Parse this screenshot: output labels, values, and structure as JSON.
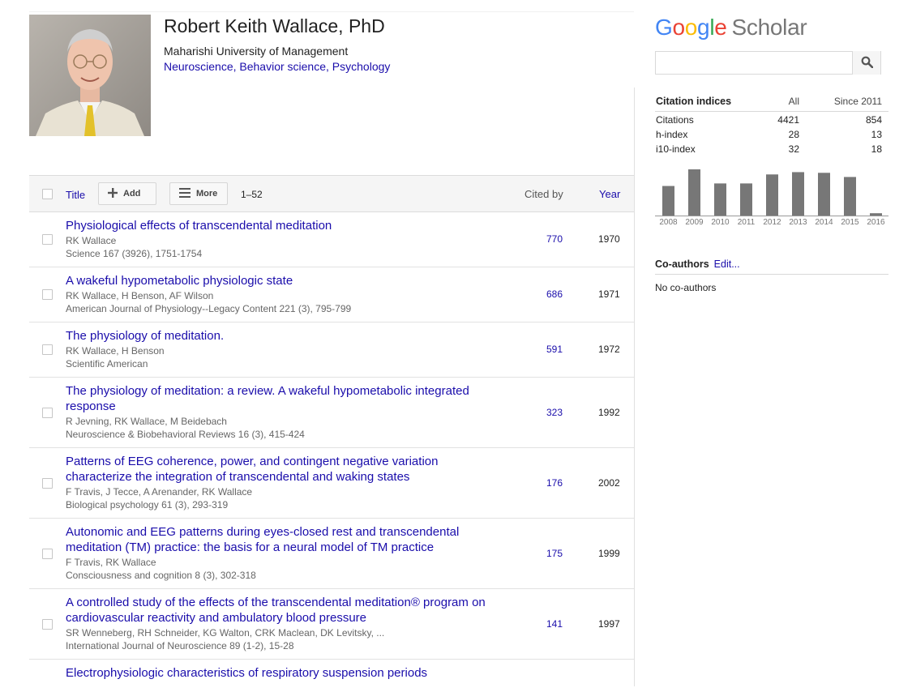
{
  "profile": {
    "name": "Robert Keith Wallace, PhD",
    "affiliation": "Maharishi University of Management",
    "interests": [
      "Neuroscience",
      "Behavior science",
      "Psychology"
    ]
  },
  "table": {
    "title_col": "Title",
    "add_label": "Add",
    "more_label": "More",
    "range": "1–52",
    "cited_col": "Cited by",
    "year_col": "Year"
  },
  "articles": [
    {
      "title": "Physiological effects of transcendental meditation",
      "authors": "RK Wallace",
      "venue": "Science 167 (3926), 1751-1754",
      "cited": "770",
      "year": "1970"
    },
    {
      "title": "A wakeful hypometabolic physiologic state",
      "authors": "RK Wallace, H Benson, AF Wilson",
      "venue": "American Journal of Physiology--Legacy Content 221 (3), 795-799",
      "cited": "686",
      "year": "1971"
    },
    {
      "title": "The physiology of meditation.",
      "authors": "RK Wallace, H Benson",
      "venue": "Scientific American",
      "cited": "591",
      "year": "1972"
    },
    {
      "title": "The physiology of meditation: a review. A wakeful hypometabolic integrated response",
      "authors": "R Jevning, RK Wallace, M Beidebach",
      "venue": "Neuroscience & Biobehavioral Reviews 16 (3), 415-424",
      "cited": "323",
      "year": "1992"
    },
    {
      "title": "Patterns of EEG coherence, power, and contingent negative variation characterize the integration of transcendental and waking states",
      "authors": "F Travis, J Tecce, A Arenander, RK Wallace",
      "venue": "Biological psychology 61 (3), 293-319",
      "cited": "176",
      "year": "2002"
    },
    {
      "title": "Autonomic and EEG patterns during eyes-closed rest and transcendental meditation (TM) practice: the basis for a neural model of TM practice",
      "authors": "F Travis, RK Wallace",
      "venue": "Consciousness and cognition 8 (3), 302-318",
      "cited": "175",
      "year": "1999"
    },
    {
      "title": "A controlled study of the effects of the transcendental meditation® program on cardiovascular reactivity and ambulatory blood pressure",
      "authors": "SR Wenneberg, RH Schneider, KG Walton, CRK Maclean, DK Levitsky, ...",
      "venue": "International Journal of Neuroscience 89 (1-2), 15-28",
      "cited": "141",
      "year": "1997"
    },
    {
      "title": "Electrophysiologic characteristics of respiratory suspension periods",
      "authors": "",
      "venue": "",
      "cited": "",
      "year": ""
    }
  ],
  "scholar": {
    "logo_google": [
      "G",
      "o",
      "o",
      "g",
      "l",
      "e"
    ],
    "logo_colors": [
      "#4285F4",
      "#EA4335",
      "#FBBC05",
      "#4285F4",
      "#34A853",
      "#EA4335"
    ],
    "logo_scholar": "Scholar",
    "search_placeholder": ""
  },
  "citation_indices": {
    "heading": "Citation indices",
    "col_all": "All",
    "col_since": "Since 2011",
    "rows": [
      {
        "label": "Citations",
        "all": "4421",
        "since": "854"
      },
      {
        "label": "h-index",
        "all": "28",
        "since": "13"
      },
      {
        "label": "i10-index",
        "all": "32",
        "since": "18"
      }
    ]
  },
  "chart_data": {
    "type": "bar",
    "categories": [
      "2008",
      "2009",
      "2010",
      "2011",
      "2012",
      "2013",
      "2014",
      "2015",
      "2016"
    ],
    "values": [
      128,
      200,
      139,
      139,
      178,
      188,
      185,
      167,
      10
    ],
    "bar_color": "#777777",
    "title": "",
    "xlabel": "",
    "ylabel": ""
  },
  "coauthors": {
    "heading": "Co-authors",
    "edit": "Edit...",
    "empty": "No co-authors"
  }
}
